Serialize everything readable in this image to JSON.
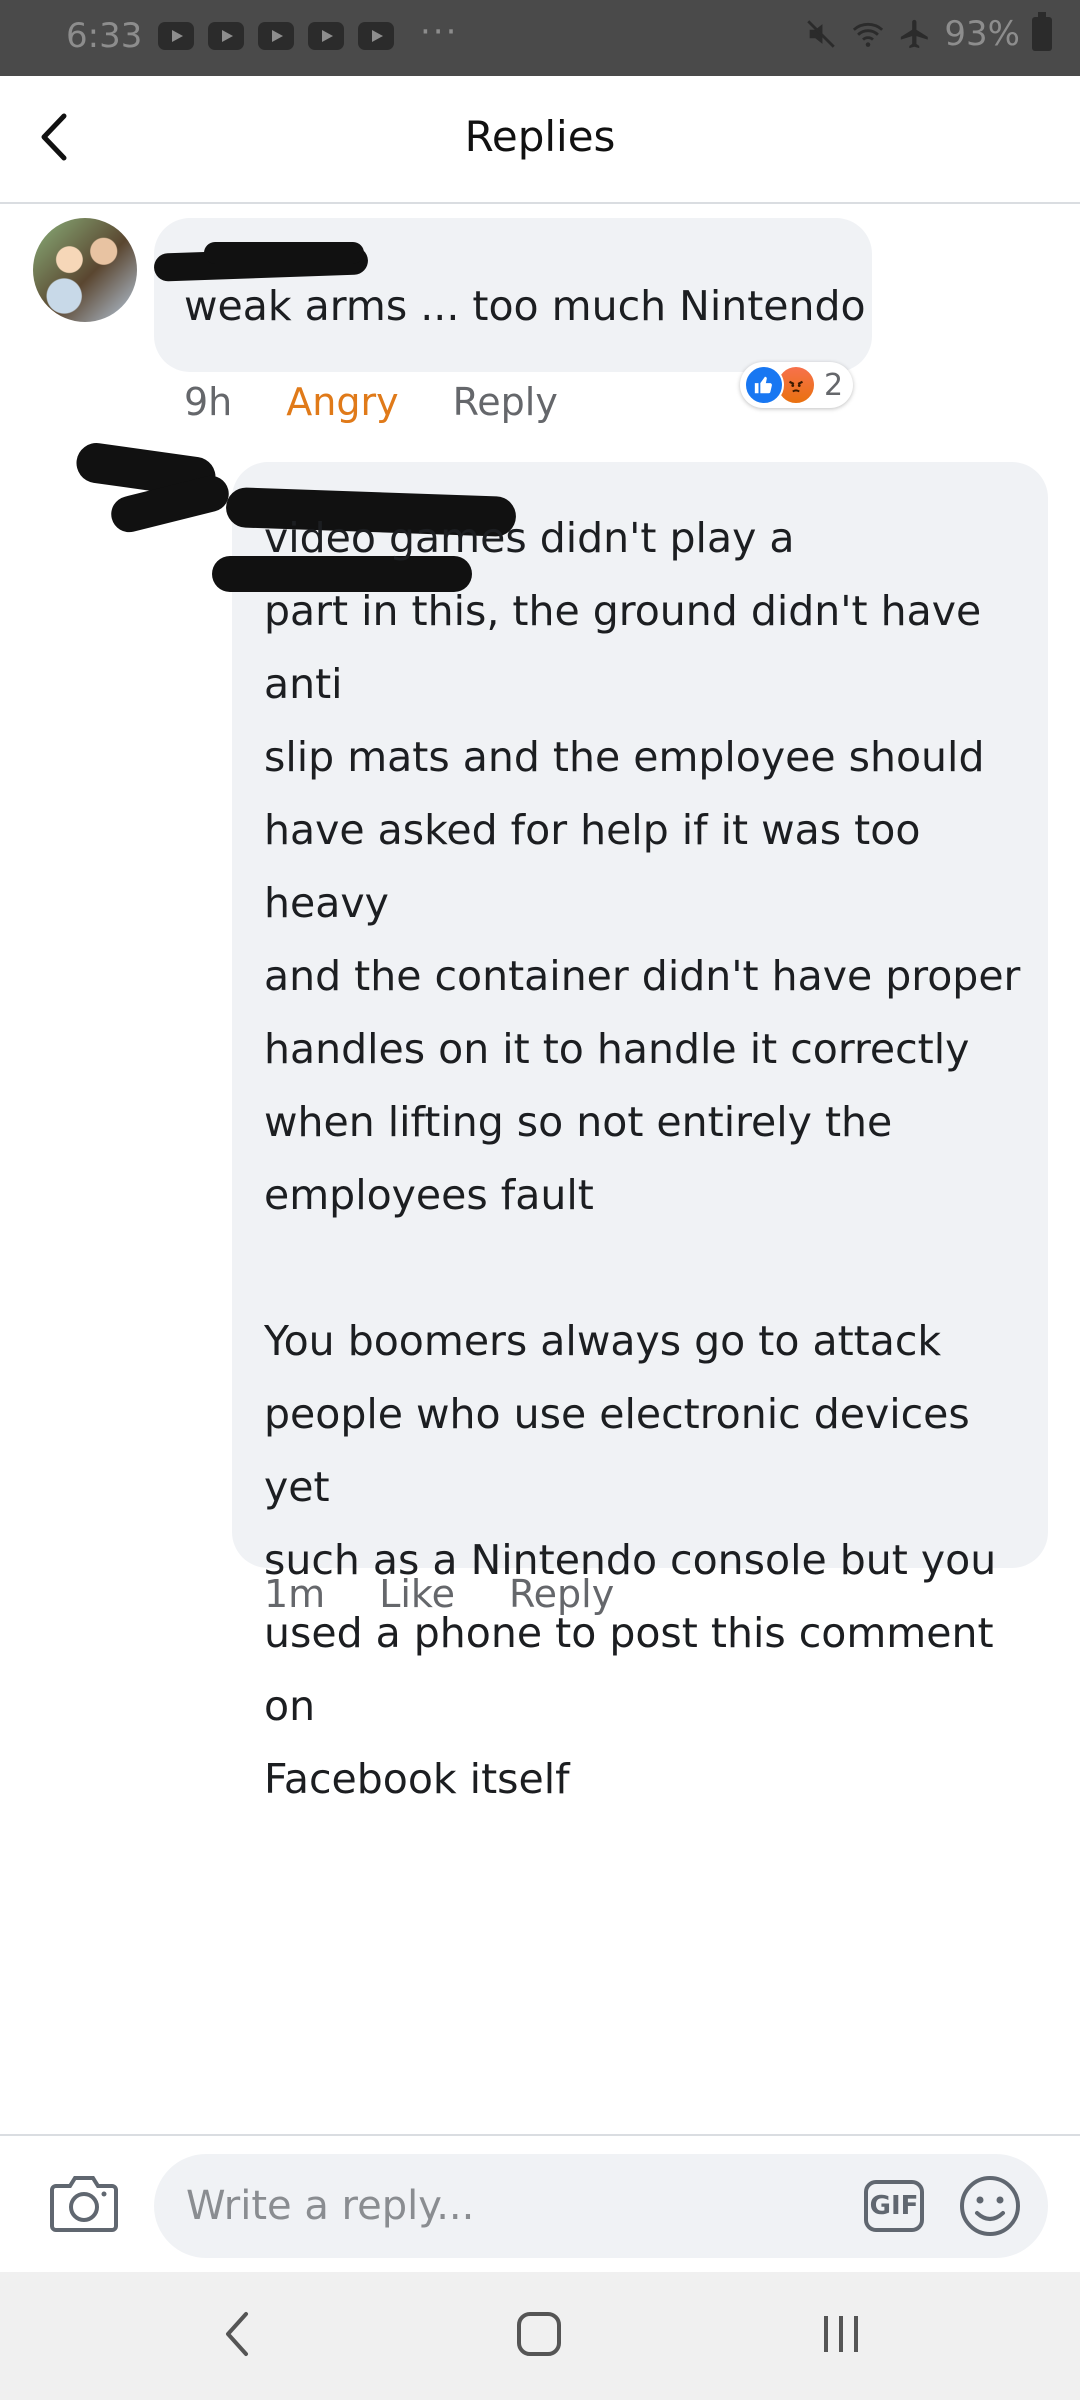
{
  "status_bar": {
    "time": "6:33",
    "more": "···",
    "battery": "93%"
  },
  "header": {
    "title": "Replies"
  },
  "comment1": {
    "text": "weak arms ... too much Nintendo",
    "time": "9h",
    "reaction_label": "Angry",
    "reply_label": "Reply",
    "reaction_count": "2"
  },
  "comment2": {
    "text": "video games didn't play a\npart in this, the ground didn't have anti\nslip mats and the employee should\nhave asked for help if it was too heavy\nand the container didn't have proper\nhandles on it to handle it correctly\nwhen lifting so not entirely the\nemployees fault\n\nYou boomers always go to attack\npeople who use electronic devices yet\nsuch as a Nintendo console but you\nused a phone to post this comment on\nFacebook itself",
    "time": "1m",
    "like_label": "Like",
    "reply_label": "Reply"
  },
  "composer": {
    "placeholder": "Write a reply...",
    "gif_label": "GIF"
  },
  "colors": {
    "accent_angry": "#e07a19",
    "like_blue": "#1877f2",
    "bubble_bg": "#f0f2f5"
  }
}
